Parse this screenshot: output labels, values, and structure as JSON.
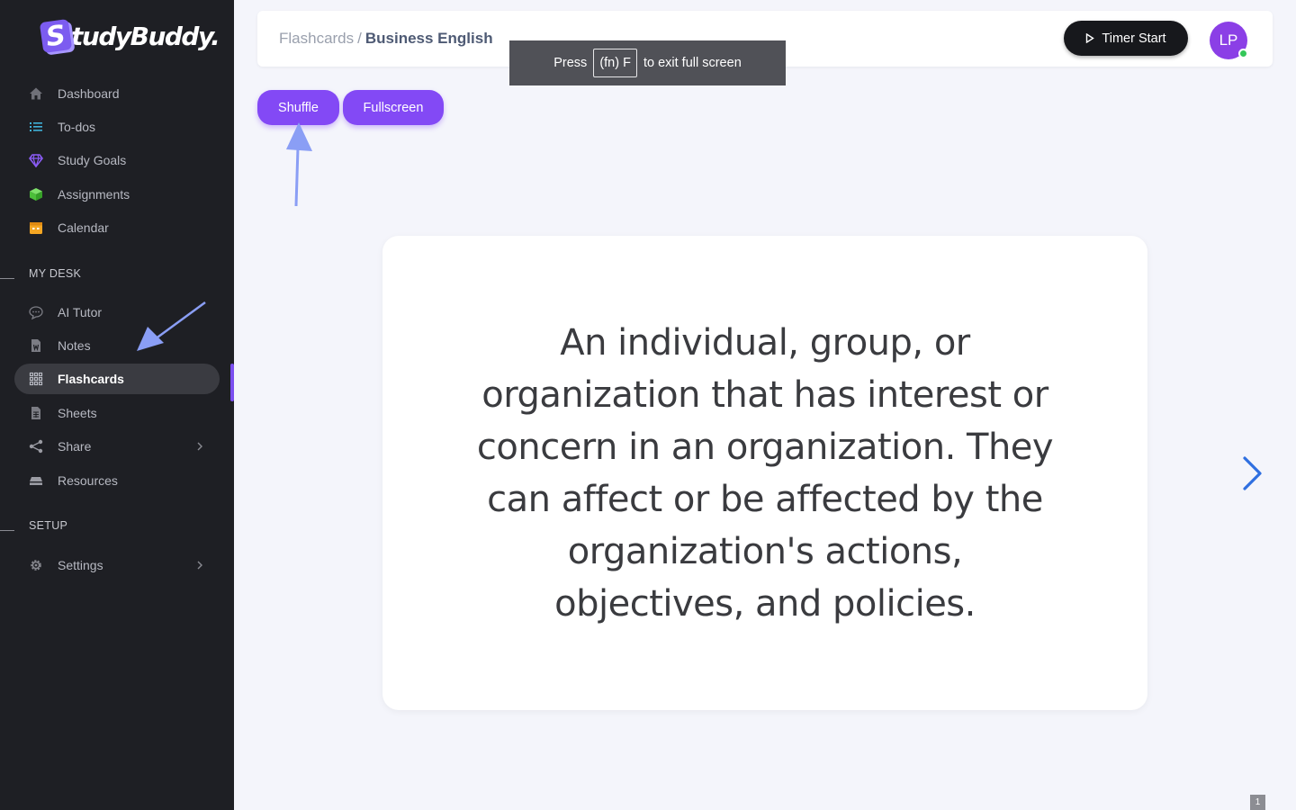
{
  "app": {
    "logo_initial": "S",
    "logo_text": "tudyBuddy."
  },
  "sidebar": {
    "items": [
      {
        "label": "Dashboard"
      },
      {
        "label": "To-dos"
      },
      {
        "label": "Study Goals"
      },
      {
        "label": "Assignments"
      },
      {
        "label": "Calendar"
      }
    ],
    "section_my_desk": "MY DESK",
    "desk_items": [
      {
        "label": "AI Tutor"
      },
      {
        "label": "Notes"
      },
      {
        "label": "Flashcards",
        "active": true
      },
      {
        "label": "Sheets"
      },
      {
        "label": "Share"
      },
      {
        "label": "Resources"
      }
    ],
    "section_setup": "SETUP",
    "setup_items": [
      {
        "label": "Settings"
      }
    ]
  },
  "header": {
    "breadcrumb_root": "Flashcards",
    "breadcrumb_sep": "/",
    "breadcrumb_current": "Business English",
    "timer_label": "Timer Start",
    "avatar_initials": "LP",
    "online": true
  },
  "toast": {
    "prefix": "Press",
    "key": "(fn) F",
    "suffix": "to exit full screen"
  },
  "toolbar": {
    "shuffle_label": "Shuffle",
    "fullscreen_label": "Fullscreen"
  },
  "card": {
    "text": "An individual, group, or organization that has interest or concern in an organization. They can affect or be affected by the organization's actions, objectives, and policies."
  },
  "page_badge": "1",
  "colors": {
    "sidebar_bg": "#1e1f24",
    "accent": "#8349f5",
    "annotation_arrow": "#8a9ef5",
    "next_arrow": "#2f6fe0"
  }
}
